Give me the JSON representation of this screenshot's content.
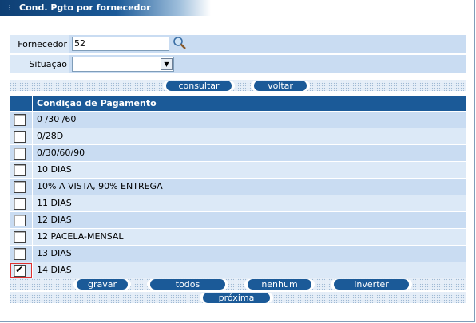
{
  "window": {
    "title": "Cond. Pgto por fornecedor"
  },
  "filters": {
    "fornecedor_label": "Fornecedor",
    "fornecedor_value": "52",
    "situacao_label": "Situação",
    "situacao_value": ""
  },
  "actions": {
    "consultar": "consultar",
    "voltar": "voltar"
  },
  "grid": {
    "header": "Condição de Pagamento",
    "rows": [
      {
        "label": "0 /30 /60",
        "checked": false
      },
      {
        "label": "0/28D",
        "checked": false
      },
      {
        "label": "0/30/60/90",
        "checked": false
      },
      {
        "label": "10 DIAS",
        "checked": false
      },
      {
        "label": "10% A VISTA, 90% ENTREGA",
        "checked": false
      },
      {
        "label": "11 DIAS",
        "checked": false
      },
      {
        "label": "12 DIAS",
        "checked": false
      },
      {
        "label": "12 PACELA-MENSAL",
        "checked": false
      },
      {
        "label": "13 DIAS",
        "checked": false
      },
      {
        "label": "14 DIAS",
        "checked": true
      }
    ]
  },
  "bottom_actions": {
    "gravar": "gravar",
    "todos": "todos",
    "nenhum": "nenhum",
    "inverter": "Inverter",
    "proxima": "próxima"
  },
  "icons": {
    "search": "search-magnifier-icon",
    "dropdown": "chevron-down-icon",
    "grip": "grip-icon"
  },
  "colors": {
    "header_blue": "#1b5a98",
    "row_light": "#dce9f7",
    "row_dark": "#c9dcf2",
    "selected_outline": "#e03030"
  }
}
